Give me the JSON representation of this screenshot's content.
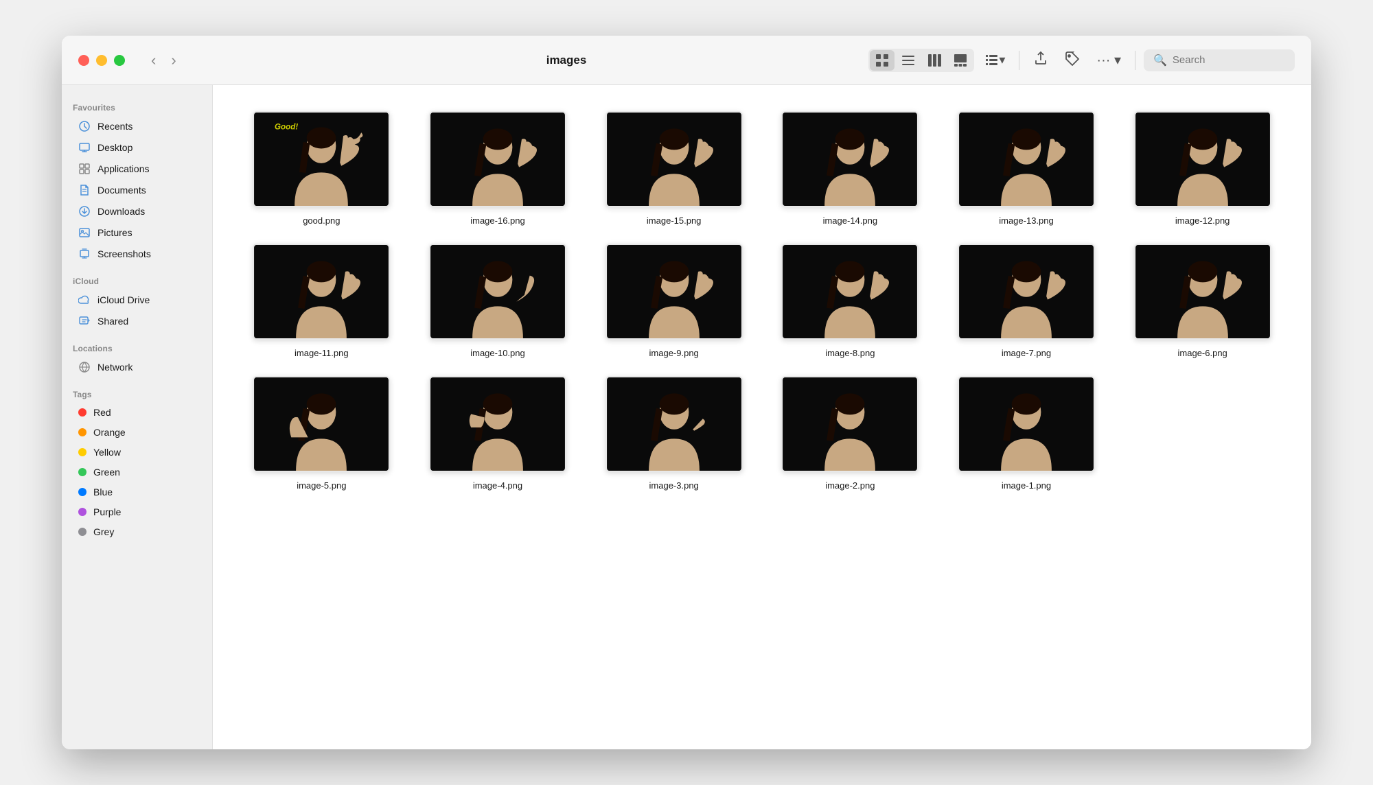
{
  "window": {
    "title": "images"
  },
  "titlebar": {
    "back_label": "‹",
    "forward_label": "›",
    "search_placeholder": "Search"
  },
  "sidebar": {
    "favourites_label": "Favourites",
    "icloud_label": "iCloud",
    "locations_label": "Locations",
    "tags_label": "Tags",
    "items": {
      "recents": "Recents",
      "desktop": "Desktop",
      "applications": "Applications",
      "documents": "Documents",
      "downloads": "Downloads",
      "pictures": "Pictures",
      "screenshots": "Screenshots",
      "icloud_drive": "iCloud Drive",
      "shared": "Shared",
      "network": "Network"
    },
    "tags": [
      {
        "name": "Red",
        "color": "#ff3b30"
      },
      {
        "name": "Orange",
        "color": "#ff9500"
      },
      {
        "name": "Yellow",
        "color": "#ffcc00"
      },
      {
        "name": "Green",
        "color": "#34c759"
      },
      {
        "name": "Blue",
        "color": "#007aff"
      },
      {
        "name": "Purple",
        "color": "#af52de"
      },
      {
        "name": "Grey",
        "color": "#8e8e93"
      }
    ]
  },
  "files": {
    "row1": [
      {
        "name": "good.png",
        "special": "good"
      },
      {
        "name": "image-16.png"
      },
      {
        "name": "image-15.png"
      },
      {
        "name": "image-14.png"
      },
      {
        "name": "image-13.png"
      },
      {
        "name": "image-12.png"
      }
    ],
    "row2": [
      {
        "name": "image-11.png"
      },
      {
        "name": "image-10.png"
      },
      {
        "name": "image-9.png"
      },
      {
        "name": "image-8.png"
      },
      {
        "name": "image-7.png"
      },
      {
        "name": "image-6.png"
      }
    ],
    "row3": [
      {
        "name": "image-5.png"
      },
      {
        "name": "image-4.png"
      },
      {
        "name": "image-3.png"
      },
      {
        "name": "image-2.png"
      },
      {
        "name": "image-1.png"
      }
    ]
  }
}
